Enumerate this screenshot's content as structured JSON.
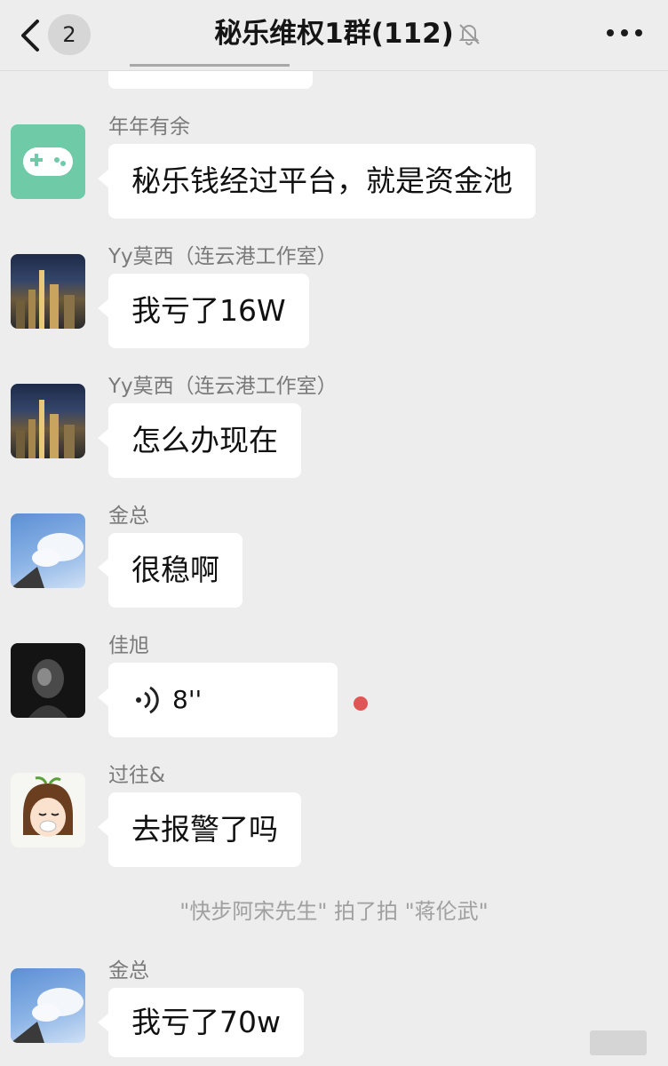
{
  "header": {
    "back_label": "",
    "unread_count": "2",
    "title": "秘乐维权1群(112)"
  },
  "messages": [
    {
      "sender": "年年有余",
      "text": "秘乐钱经过平台，就是资金池",
      "avatar": "gamepad-avatar"
    },
    {
      "sender": "Yy莫西（连云港工作室）",
      "text": "我亏了16W",
      "avatar": "city-night-avatar"
    },
    {
      "sender": "Yy莫西（连云港工作室）",
      "text": "怎么办现在",
      "avatar": "city-night-avatar"
    },
    {
      "sender": "金总",
      "text": "很稳啊",
      "avatar": "sky-avatar"
    },
    {
      "sender": "佳旭",
      "voice_duration": "8''",
      "avatar": "portrait-bw-avatar"
    },
    {
      "sender": "过往&",
      "text": "去报警了吗",
      "avatar": "cartoon-girl-avatar"
    },
    {
      "sender": "金总",
      "text": "我亏了70w",
      "avatar": "sky-avatar"
    }
  ],
  "system_note": "\"快步阿宋先生\" 拍了拍 \"蒋伦武\"",
  "colors": {
    "background": "#ededed",
    "bubble": "#ffffff",
    "gamepad_avatar": "#6fcaa8",
    "unread_dot": "#e05555"
  },
  "icons": [
    "back-icon",
    "mute-icon",
    "more-icon",
    "voice-icon",
    "gamepad-icon"
  ]
}
